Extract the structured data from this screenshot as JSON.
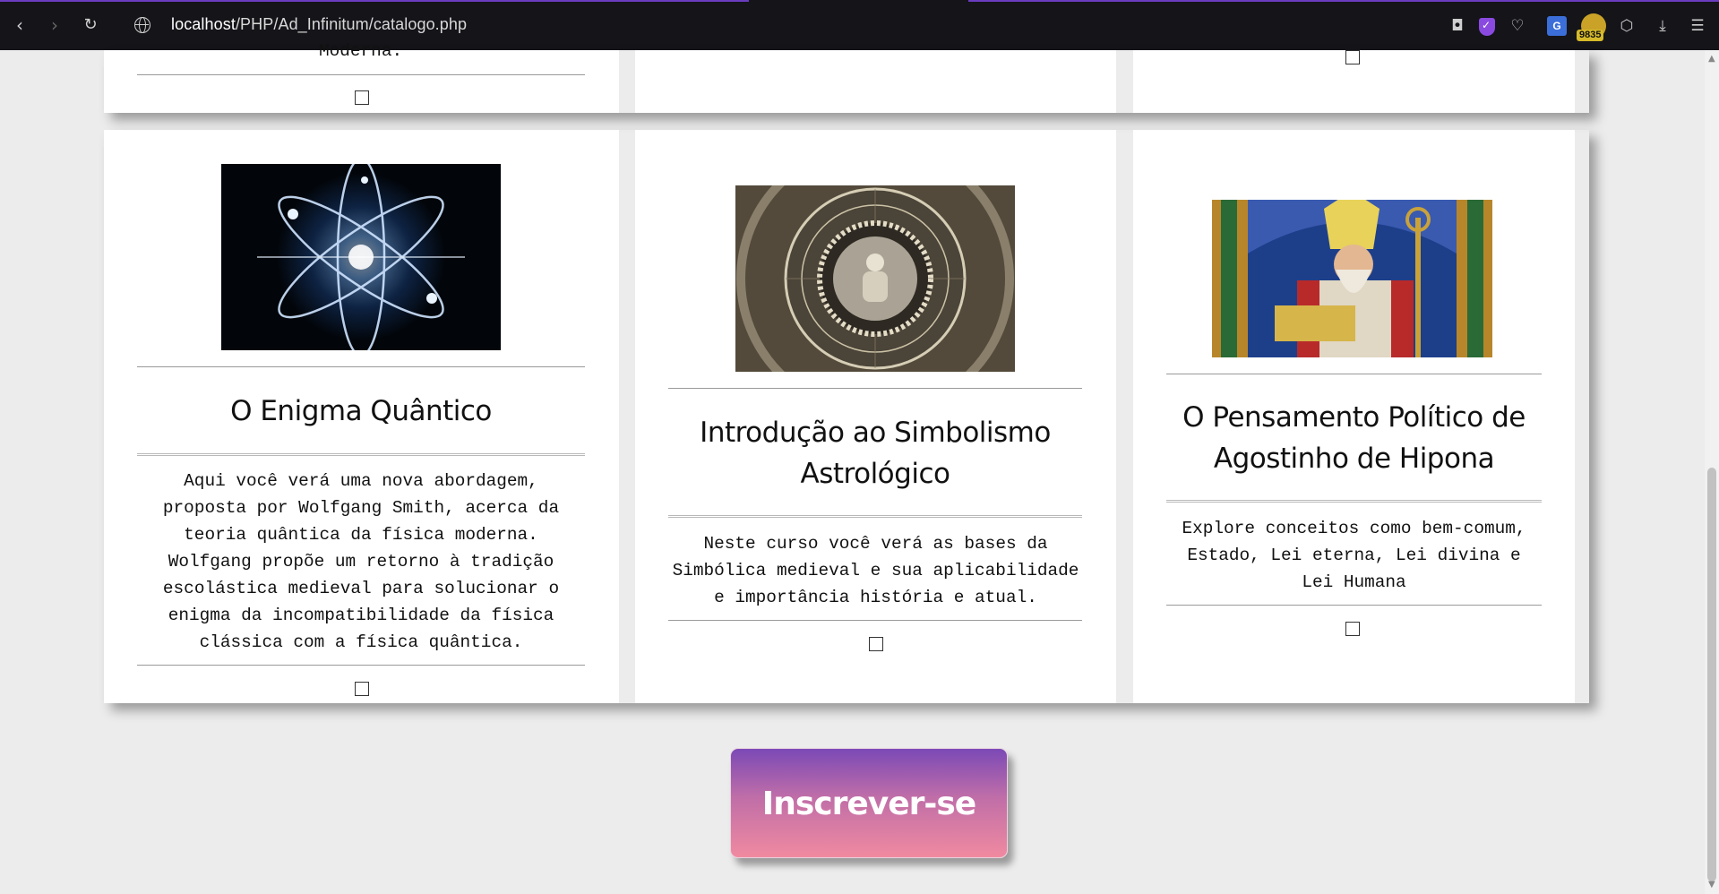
{
  "browser": {
    "url_host": "localhost",
    "url_path": "/PHP/Ad_Infinitum/catalogo.php",
    "extension_badge": "9835",
    "translate_label": "G"
  },
  "top_row": {
    "partial_text": "Moderna."
  },
  "courses": [
    {
      "title": "O Enigma Quântico",
      "description": [
        "Aqui você verá uma nova abordagem,",
        "proposta por Wolfgang Smith, acerca da",
        "teoria quântica da física moderna.",
        "Wolfgang propõe um retorno à tradição",
        "escolástica medieval para solucionar o",
        "enigma da incompatibilidade da física",
        "clássica com a física quântica."
      ],
      "checked": false
    },
    {
      "title": "Introdução ao Simbolismo Astrológico",
      "title_lines": [
        "Introdução ao Simbolismo",
        "Astrológico"
      ],
      "description": [
        "Neste curso você verá as bases da",
        "Simbólica medieval e sua aplicabilidade",
        "e importância história e atual."
      ],
      "checked": false
    },
    {
      "title": "O Pensamento Político de Agostinho de Hipona",
      "title_lines": [
        "O Pensamento Político de",
        "Agostinho de Hipona"
      ],
      "description": [
        "Explore conceitos como bem-comum,",
        "Estado, Lei eterna, Lei divina e",
        "Lei Humana"
      ],
      "checked": false
    }
  ],
  "subscribe_button": {
    "label": "Inscrever-se"
  },
  "colors": {
    "page_bg": "#ececec",
    "card_bg": "#ffffff",
    "button_top": "#7b49b6",
    "button_bottom": "#f08aa0",
    "browser_bar": "#141419"
  }
}
